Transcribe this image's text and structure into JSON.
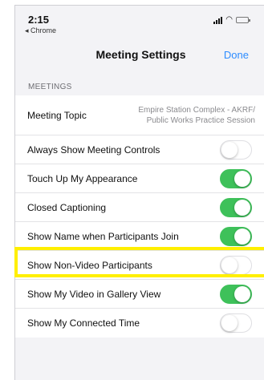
{
  "status": {
    "time": "2:15",
    "back_app": "◂ Chrome"
  },
  "nav": {
    "title": "Meeting Settings",
    "done": "Done"
  },
  "section": {
    "header": "MEETINGS"
  },
  "rows": [
    {
      "label": "Meeting Topic",
      "value_line1": "Empire Station Complex - AKRF/",
      "value_line2": "Public Works Practice Session"
    },
    {
      "label": "Always Show Meeting Controls",
      "on": false
    },
    {
      "label": "Touch Up My Appearance",
      "on": true
    },
    {
      "label": "Closed Captioning",
      "on": true
    },
    {
      "label": "Show Name when Participants Join",
      "on": true
    },
    {
      "label": "Show Non-Video Participants",
      "on": false
    },
    {
      "label": "Show My Video in Gallery View",
      "on": true
    },
    {
      "label": "Show My Connected Time",
      "on": false
    }
  ],
  "colors": {
    "accent": "#2d8cff",
    "toggle_on": "#3ec15a",
    "highlight": "#ffef00"
  }
}
